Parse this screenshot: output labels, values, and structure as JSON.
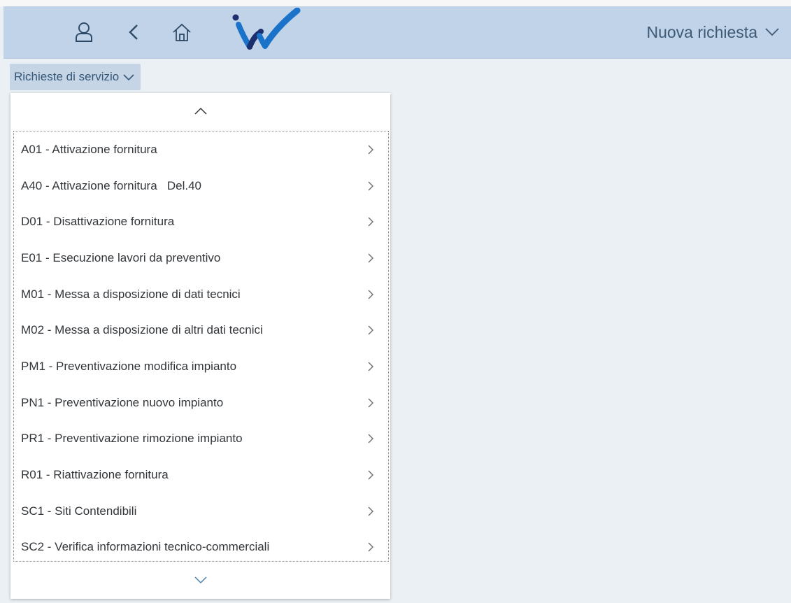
{
  "header": {
    "title": "Nuova richiesta",
    "icons": {
      "user": "user-icon",
      "back": "back-icon",
      "home": "home-icon",
      "logo": "checkmark-logo",
      "title_menu": "chevron-down-icon"
    }
  },
  "menu": {
    "label": "Richieste di servizio",
    "icon": "chevron-down-icon"
  },
  "popup": {
    "scroll_up_icon": "chevron-up-icon",
    "scroll_down_icon": "chevron-down-icon",
    "items": [
      {
        "label": "A01 - Attivazione fornitura"
      },
      {
        "label": "A40 - Attivazione fornitura   Del.40"
      },
      {
        "label": "D01 - Disattivazione fornitura"
      },
      {
        "label": "E01 - Esecuzione lavori da preventivo"
      },
      {
        "label": "M01 - Messa a disposizione di dati tecnici"
      },
      {
        "label": "M02 - Messa a disposizione di altri dati tecnici"
      },
      {
        "label": "PM1 - Preventivazione modifica impianto"
      },
      {
        "label": "PN1 - Preventivazione nuovo impianto"
      },
      {
        "label": "PR1 - Preventivazione rimozione impianto"
      },
      {
        "label": "R01 - Riattivazione fornitura"
      },
      {
        "label": "SC1 - Siti Contendibili"
      },
      {
        "label": "SC2 - Verifica informazioni tecnico-commerciali"
      }
    ]
  },
  "colors": {
    "header_bg": "#c1d3e8",
    "page_bg": "#ebf0f5",
    "icon": "#2f4a66",
    "logo_blue": "#1a73c9",
    "logo_dark": "#1c2f6e"
  }
}
